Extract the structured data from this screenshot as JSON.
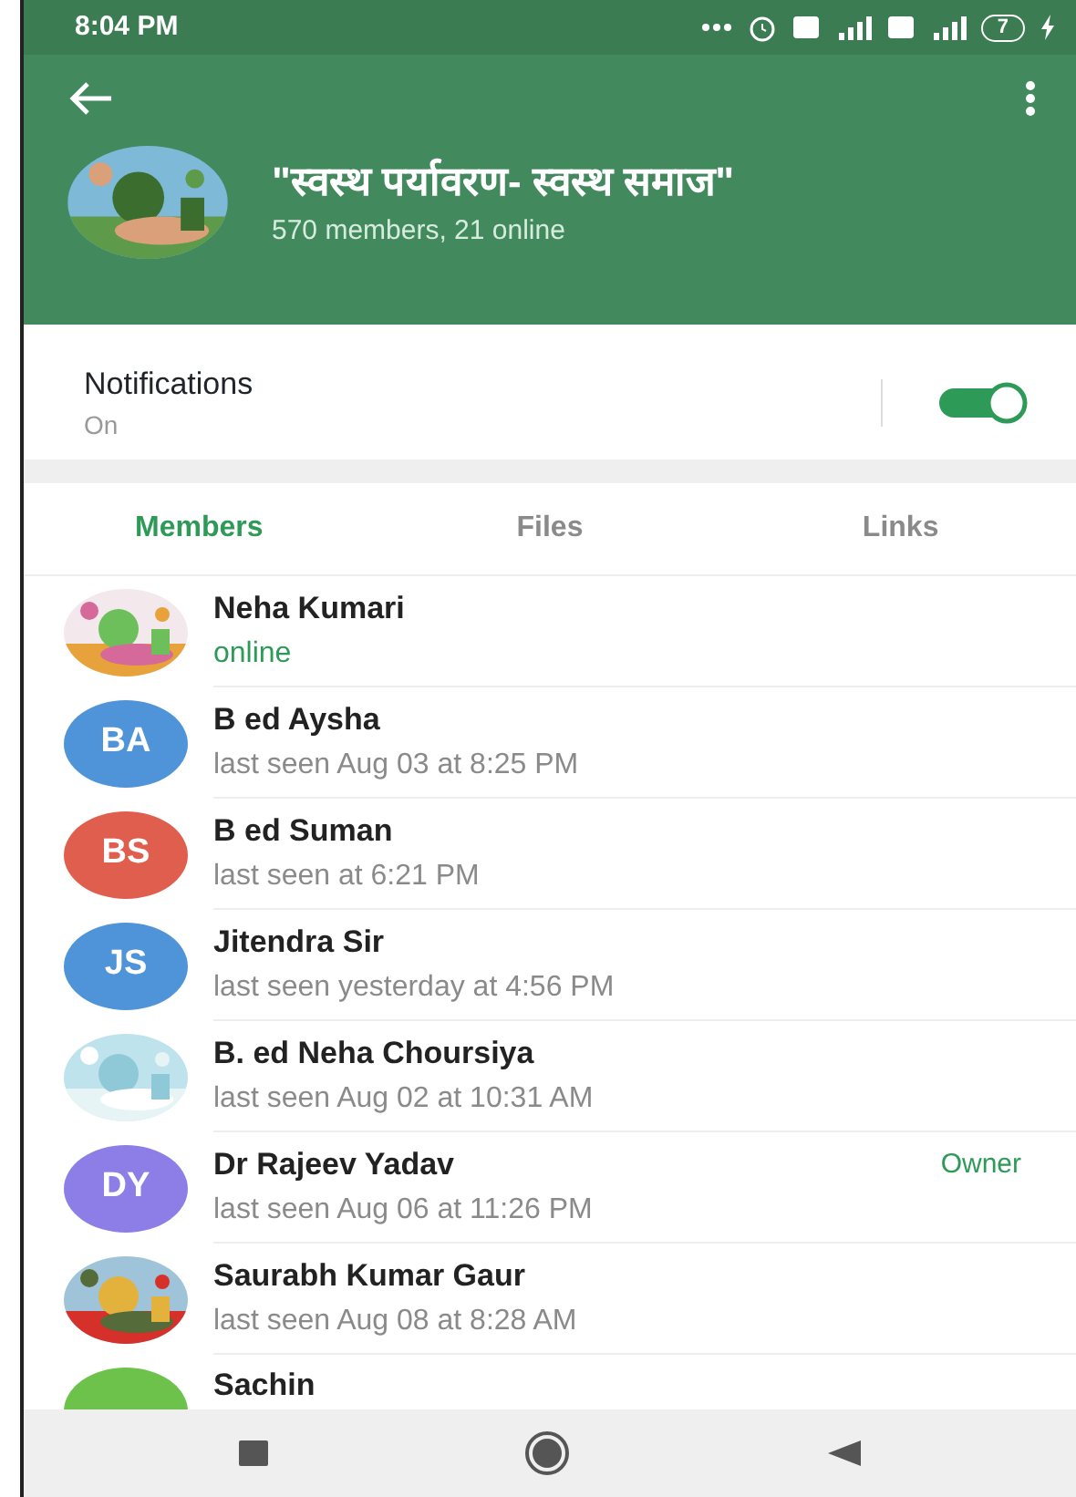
{
  "status_bar": {
    "time": "8:04 PM",
    "battery": "7"
  },
  "header": {
    "title": "\"स्वस्थ पर्यावरण- स्वस्थ समाज\"",
    "subtitle": "570 members, 21 online"
  },
  "notifications": {
    "label": "Notifications",
    "value": "On",
    "on": true
  },
  "tabs": [
    {
      "label": "Members",
      "selected": true
    },
    {
      "label": "Files",
      "selected": false
    },
    {
      "label": "Links",
      "selected": false
    }
  ],
  "members": [
    {
      "name": "Neha Kumari",
      "status": "online",
      "online": true
    },
    {
      "name": "B ed Aysha",
      "status": "last seen Aug 03 at 8:25 PM",
      "online": false,
      "avatar": {
        "kind": "initials",
        "initials": "BA",
        "color": "#4f94d8"
      }
    },
    {
      "name": "B ed Suman",
      "status": "last seen at 6:21 PM",
      "online": false,
      "avatar": {
        "kind": "initials",
        "initials": "BS",
        "color": "#e05e4e"
      }
    },
    {
      "name": "Jitendra Sir",
      "status": "last seen yesterday at 4:56 PM",
      "online": false,
      "avatar": {
        "kind": "initials",
        "initials": "JS",
        "color": "#4f94d8"
      }
    },
    {
      "name": "B. ed Neha Choursiya",
      "status": "last seen Aug 02 at 10:31 AM",
      "online": false
    },
    {
      "name": "Dr Rajeev Yadav",
      "status": "last seen Aug 06 at 11:26 PM",
      "online": false,
      "role": "Owner",
      "avatar": {
        "kind": "initials",
        "initials": "DY",
        "color": "#8c7ee6"
      }
    },
    {
      "name": "Saurabh Kumar Gaur",
      "status": "last seen Aug 08 at 8:28 AM",
      "online": false
    },
    {
      "name": "Sachin",
      "avatar": {
        "kind": "initials",
        "color": "#6cc24a"
      }
    }
  ]
}
